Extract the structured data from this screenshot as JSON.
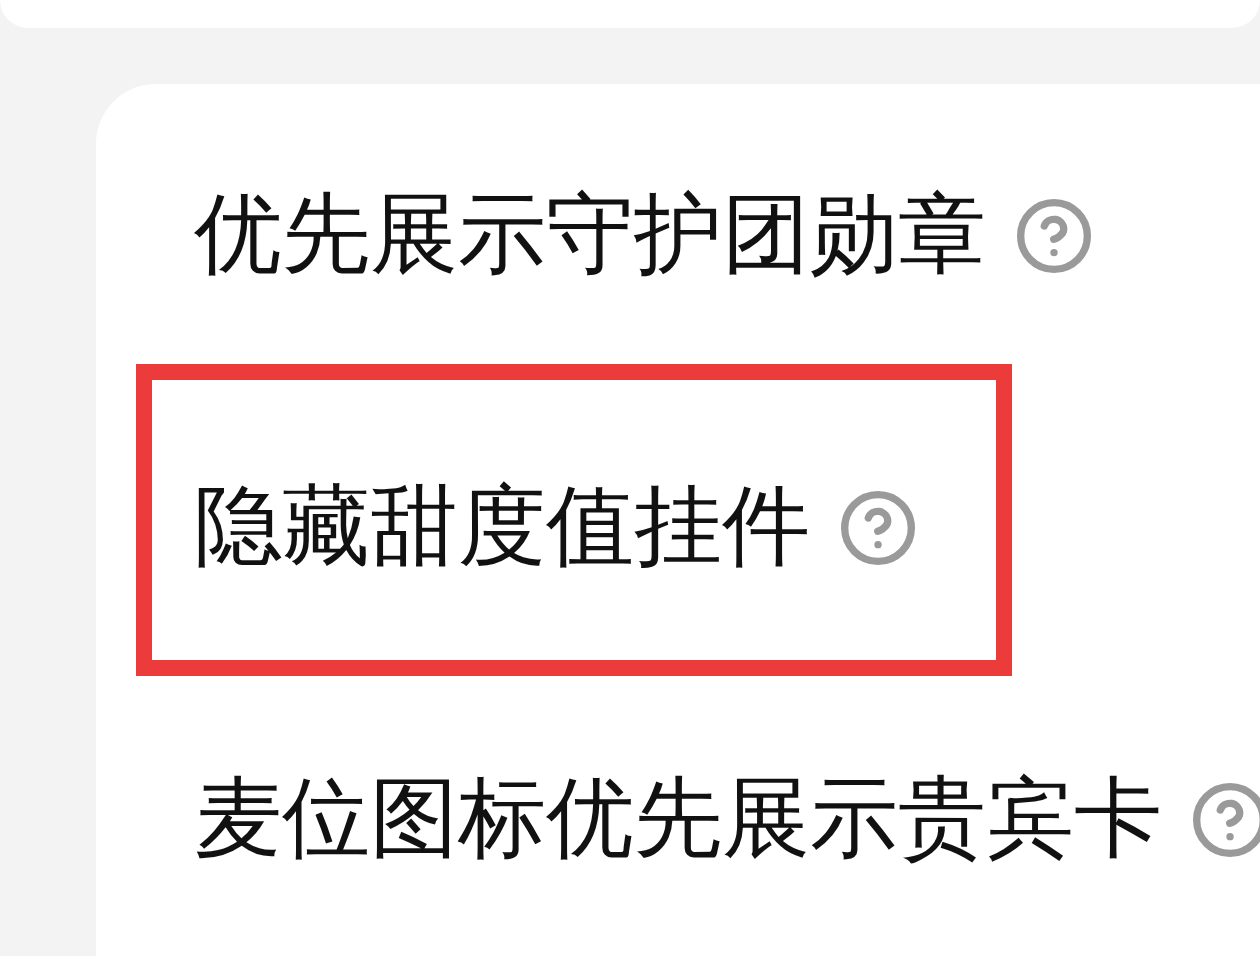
{
  "settings": [
    {
      "label": "优先展示守护团勋章",
      "highlighted": false
    },
    {
      "label": "隐藏甜度值挂件",
      "highlighted": true
    },
    {
      "label": "麦位图标优先展示贵宾卡",
      "highlighted": false
    }
  ]
}
